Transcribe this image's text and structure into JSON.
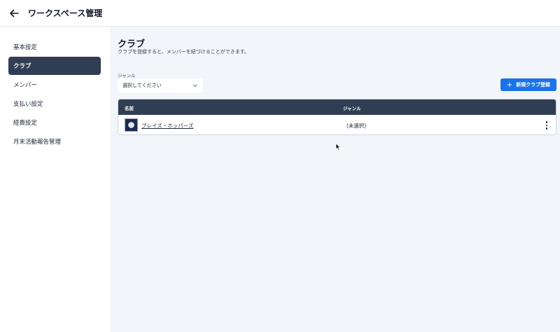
{
  "header": {
    "back_icon": "arrow-left-icon",
    "title": "ワークスペース管理"
  },
  "sidebar": {
    "items": [
      {
        "label": "基本設定",
        "active": false
      },
      {
        "label": "クラブ",
        "active": true
      },
      {
        "label": "メンバー",
        "active": false
      },
      {
        "label": "支払い設定",
        "active": false
      },
      {
        "label": "経費設定",
        "active": false
      },
      {
        "label": "月末活動報告管理",
        "active": false
      }
    ]
  },
  "main": {
    "title": "クラブ",
    "description": "クラブを登録すると、メンバーを紐づけることができます。",
    "genre_filter": {
      "label": "ジャンル",
      "selected": "選択してください"
    },
    "new_button": {
      "icon": "plus-icon",
      "label": "新規クラブ登録"
    },
    "table": {
      "columns": [
        "名前",
        "ジャンル"
      ],
      "rows": [
        {
          "name": "ブレイズ・ホッパーズ",
          "genre": "(未選択)"
        }
      ]
    }
  },
  "colors": {
    "primary": "#1a73e8",
    "nav_active": "#2f3e52",
    "content_bg": "#f2f5fa"
  }
}
